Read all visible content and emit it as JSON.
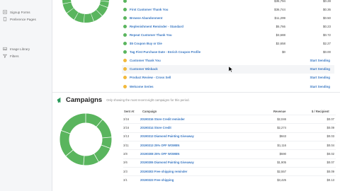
{
  "sidebar": {
    "items": [
      {
        "label": "Signup Forms",
        "icon": "form-icon"
      },
      {
        "label": "Preference Pages",
        "icon": "page-icon"
      },
      {
        "label": "Image Library",
        "icon": "image-icon"
      },
      {
        "label": "Filters",
        "icon": "filter-icon"
      }
    ]
  },
  "flows": {
    "rows": [
      {
        "name": "",
        "a": "$35,794",
        "b": "$0.28",
        "status": "green",
        "action": ""
      },
      {
        "name": "First Customer Thank You",
        "a": "$36,744",
        "b": "$0.36",
        "status": "green",
        "action": ""
      },
      {
        "name": "Browse Abandonment",
        "a": "$11,299",
        "b": "$0.50",
        "status": "green",
        "action": ""
      },
      {
        "name": "Replenishment Reminder - Standard",
        "a": "$5,766",
        "b": "$0.23",
        "status": "green",
        "action": ""
      },
      {
        "name": "Repeat Customer Thank You",
        "a": "$3,688",
        "b": "$0.72",
        "status": "green",
        "action": ""
      },
      {
        "name": "$5 Coupon Buy or Die",
        "a": "$2,658",
        "b": "$2.27",
        "status": "green",
        "action": ""
      },
      {
        "name": "Tag First Purchase Date - Enrich Coupon Profile",
        "a": "$0",
        "b": "$0.00",
        "status": "green",
        "action": ""
      },
      {
        "name": "Customer Thank You",
        "a": "",
        "b": "",
        "status": "yellow",
        "action": "Start Sending"
      },
      {
        "name": "Customer Winback",
        "a": "",
        "b": "",
        "status": "yellow",
        "action": "Start Sending"
      },
      {
        "name": "Product Review - Cross Sell",
        "a": "",
        "b": "",
        "status": "yellow",
        "action": "Start Sending"
      },
      {
        "name": "Welcome Series",
        "a": "",
        "b": "",
        "status": "yellow",
        "action": "Start Sending"
      }
    ]
  },
  "campaigns": {
    "title": "Campaigns",
    "subtitle": "Only showing the most recent eight campaigns for this period.",
    "headers": {
      "sent_at": "Sent At",
      "campaign": "Campaign",
      "revenue": "Revenue",
      "per_recipient": "$ / Recipient"
    },
    "rows": [
      {
        "sent": "3/16",
        "name": "20190316 Store Credit reminder",
        "revenue": "$2,046",
        "per": "$0.07"
      },
      {
        "sent": "3/16",
        "name": "20190314 Store Credit",
        "revenue": "$2,274",
        "per": "$0.09"
      },
      {
        "sent": "3/13",
        "name": "20190313 Diamond Painting Giveaway",
        "revenue": "$843",
        "per": "$0.03"
      },
      {
        "sent": "3/11",
        "name": "20190313 25% OFF WOMEN",
        "revenue": "$1,116",
        "per": "$0.04"
      },
      {
        "sent": "3/8",
        "name": "20190308 25% OFF WOMEN",
        "revenue": "$590",
        "per": "$0.02"
      },
      {
        "sent": "3/6",
        "name": "20190306 Diamond Painting Giveaway",
        "revenue": "$1,905",
        "per": "$0.07"
      },
      {
        "sent": "3/3",
        "name": "20190303 Free shipping reminder",
        "revenue": "$2,557",
        "per": "$0.09"
      },
      {
        "sent": "3/1",
        "name": "20190323 Free shipping",
        "revenue": "$3,425",
        "per": "$0.13"
      }
    ]
  },
  "colors": {
    "accent_green": "#5ab55e",
    "link_blue": "#3a78c3",
    "pending_yellow": "#f2b93b"
  }
}
